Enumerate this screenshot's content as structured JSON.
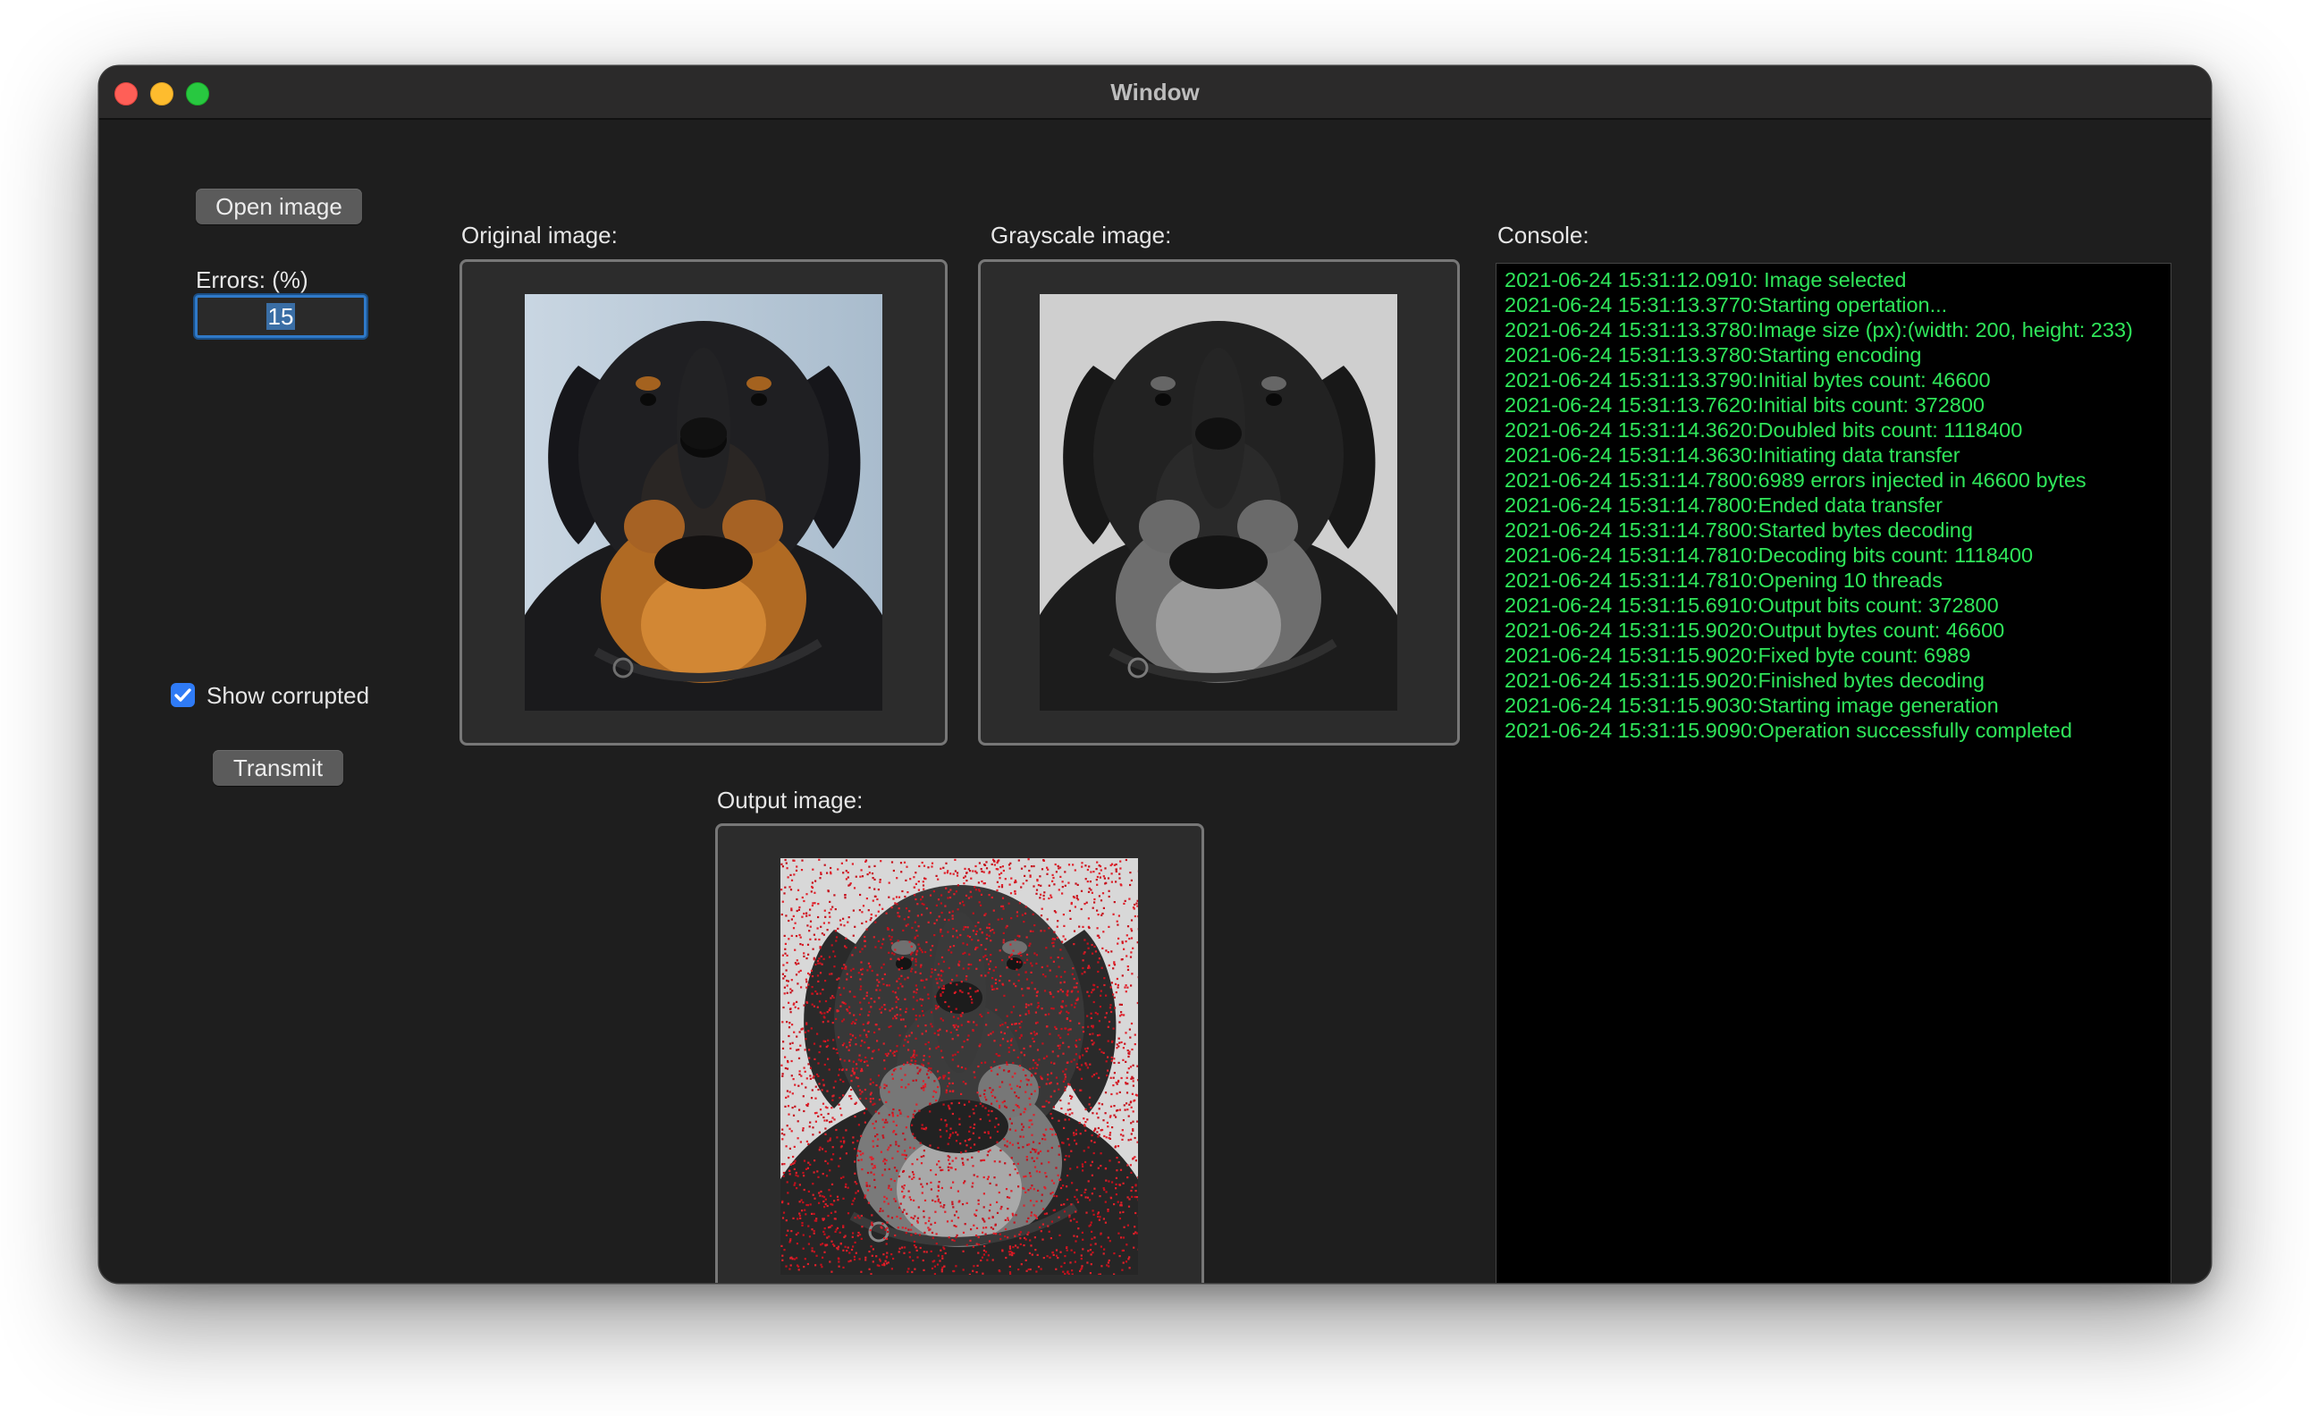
{
  "window": {
    "title": "Window"
  },
  "controls": {
    "open_button": "Open image",
    "errors_label": "Errors: (%)",
    "errors_value": "15",
    "show_corrupted_label": "Show corrupted",
    "show_corrupted_checked": true,
    "transmit_button": "Transmit"
  },
  "panels": {
    "original_label": "Original image:",
    "grayscale_label": "Grayscale image:",
    "output_label": "Output image:",
    "console_label": "Console:"
  },
  "console": {
    "lines": [
      "2021-06-24 15:31:12.0910: Image selected",
      "2021-06-24 15:31:13.3770:Starting opertation...",
      "2021-06-24 15:31:13.3780:Image size (px):(width: 200, height: 233)",
      "2021-06-24 15:31:13.3780:Starting encoding",
      "2021-06-24 15:31:13.3790:Initial bytes count: 46600",
      "2021-06-24 15:31:13.7620:Initial bits count: 372800",
      "2021-06-24 15:31:14.3620:Doubled bits count: 1118400",
      "2021-06-24 15:31:14.3630:Initiating data transfer",
      "2021-06-24 15:31:14.7800:6989 errors injected in 46600 bytes",
      "2021-06-24 15:31:14.7800:Ended data transfer",
      "2021-06-24 15:31:14.7800:Started bytes decoding",
      "2021-06-24 15:31:14.7810:Decoding bits count: 1118400",
      "2021-06-24 15:31:14.7810:Opening 10 threads",
      "2021-06-24 15:31:15.6910:Output bits count: 372800",
      "2021-06-24 15:31:15.9020:Output bytes count: 46600",
      "2021-06-24 15:31:15.9020:Fixed byte count: 6989",
      "2021-06-24 15:31:15.9020:Finished bytes decoding",
      "2021-06-24 15:31:15.9030:Starting image generation",
      "2021-06-24 15:31:15.9090:Operation successfully completed"
    ]
  },
  "colors": {
    "console_text": "#2fe65a",
    "accent": "#2f7bf6",
    "window_bg": "#1e1e1e"
  }
}
